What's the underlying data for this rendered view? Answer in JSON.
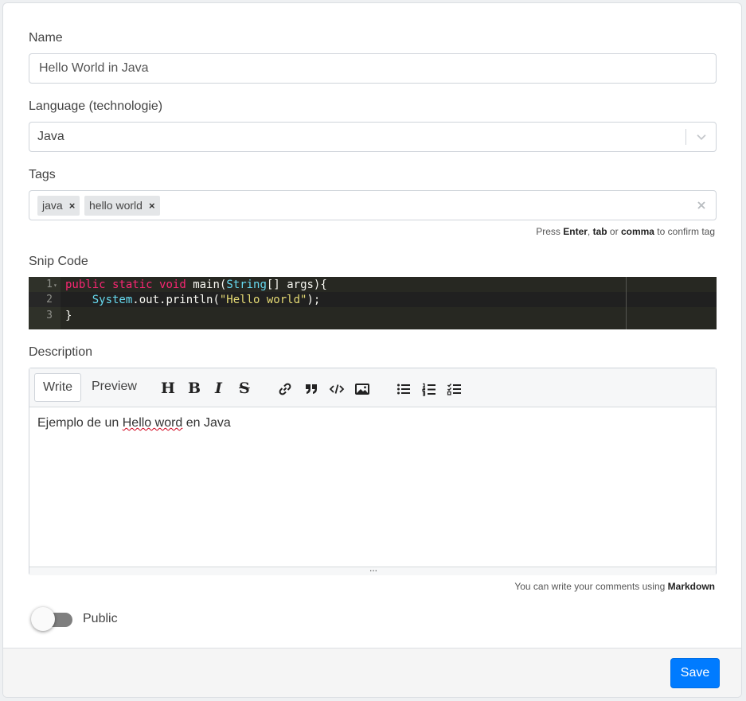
{
  "form": {
    "name_label": "Name",
    "name_value": "Hello World in Java",
    "language_label": "Language (technologie)",
    "language_value": "Java",
    "tags_label": "Tags",
    "tags": [
      "java",
      "hello world"
    ],
    "tag_remove": "×",
    "tags_hint": {
      "prefix": "Press ",
      "enter": "Enter",
      "sep1": ", ",
      "tab": "tab",
      "or": " or ",
      "comma": "comma",
      "suffix": " to confirm tag"
    },
    "code_label": "Snip Code",
    "code_lines": {
      "l1": [
        "public",
        "static",
        "void",
        "main(",
        "String",
        "[] args){"
      ],
      "l2": [
        "System",
        ".out.println(",
        "\"Hello world\"",
        ");"
      ],
      "l3": [
        "}"
      ]
    },
    "line_numbers": [
      "1",
      "2",
      "3"
    ],
    "description_label": "Description",
    "editor": {
      "tab_write": "Write",
      "tab_preview": "Preview",
      "tool_heading": "H",
      "tool_bold": "B",
      "tool_italic": "I",
      "tool_strike": "S",
      "text_before": "Ejemplo de un ",
      "text_misspelled": "Hello word",
      "text_after": " en Java",
      "resize_handle": "..."
    },
    "markdown_hint": {
      "prefix": "You can write your comments using ",
      "link": "Markdown"
    },
    "public_label": "Public",
    "public_on": false
  },
  "footer": {
    "save_label": "Save"
  },
  "colors": {
    "primary": "#007bff",
    "code_bg": "#272822",
    "keyword": "#f92672",
    "type": "#66d9ef",
    "string": "#e6db74"
  }
}
